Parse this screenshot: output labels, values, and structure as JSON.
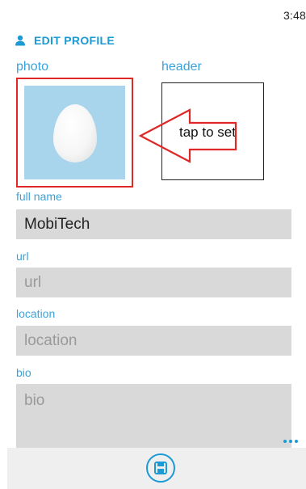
{
  "status_bar": {
    "time": "3:48"
  },
  "page": {
    "title": "EDIT PROFILE",
    "icon": "person-icon"
  },
  "photo": {
    "label": "photo",
    "image": "egg-avatar"
  },
  "header_image": {
    "label": "header",
    "placeholder": "tap to set"
  },
  "fields": {
    "full_name": {
      "label": "full name",
      "value": "MobiTech"
    },
    "url": {
      "label": "url",
      "placeholder": "url"
    },
    "location": {
      "label": "location",
      "placeholder": "location"
    },
    "bio": {
      "label": "bio",
      "placeholder": "bio"
    }
  },
  "app_bar": {
    "buttons": [
      "save-icon"
    ],
    "more": "more-icon"
  },
  "colors": {
    "accent": "#1b9ad6",
    "annotation": "#e02828",
    "field_bg": "#d9d9d9",
    "photo_bg": "#a9d5ec"
  }
}
